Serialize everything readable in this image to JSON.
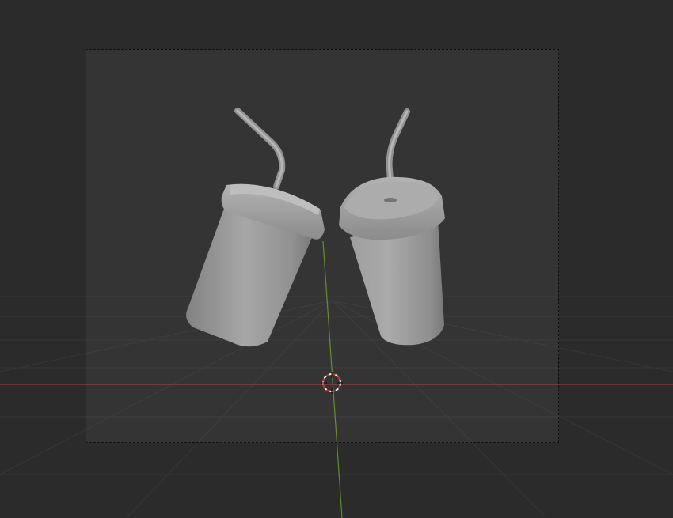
{
  "viewport": {
    "background": "#2b2b2b",
    "grid_color": "#3a3a3a",
    "x_axis_color": "#8a3a44",
    "y_axis_color": "#5f8a2c"
  },
  "objects": [
    {
      "name": "cup-with-straw-left",
      "color": "#9a9a9a"
    },
    {
      "name": "cup-with-straw-right",
      "color": "#9a9a9a"
    }
  ],
  "cursor_3d": {
    "ring_colors": [
      "#cc2b2b",
      "#ffffff"
    ]
  }
}
